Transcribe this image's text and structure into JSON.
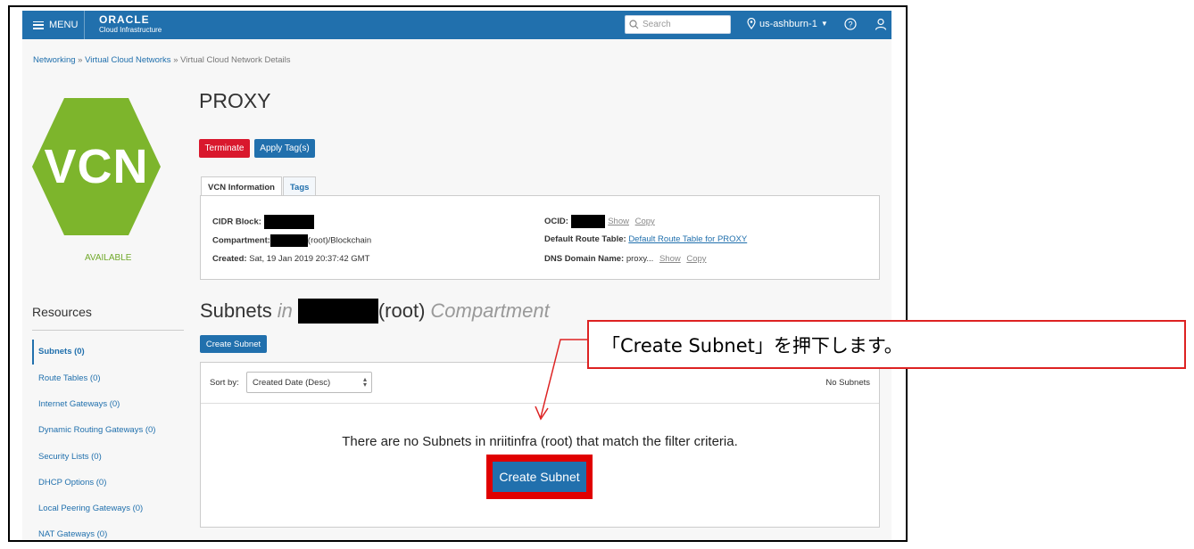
{
  "topbar": {
    "menu_label": "MENU",
    "brand_name": "ORACLE",
    "brand_sub": "Cloud Infrastructure",
    "search_placeholder": "Search",
    "region": "us-ashburn-1"
  },
  "breadcrumb": {
    "item1": "Networking",
    "sep": "»",
    "item2": "Virtual Cloud Networks",
    "item3": "Virtual Cloud Network Details"
  },
  "vcn": {
    "badge": "VCN",
    "status": "AVAILABLE",
    "title": "PROXY",
    "terminate_label": "Terminate",
    "apply_tags_label": "Apply Tag(s)"
  },
  "tabs": [
    "VCN Information",
    "Tags"
  ],
  "info": {
    "cidr_label": "CIDR Block:",
    "compartment_label": "Compartment:",
    "compartment_suffix": "(root)/Blockchain",
    "created_label": "Created:",
    "created_value": "Sat, 19 Jan 2019 20:37:42 GMT",
    "ocid_label": "OCID:",
    "show_label": "Show",
    "copy_label": "Copy",
    "route_table_label": "Default Route Table:",
    "route_table_value": "Default Route Table for PROXY",
    "dns_label": "DNS Domain Name:",
    "dns_value": "proxy..."
  },
  "resources": {
    "title": "Resources",
    "items": [
      "Subnets (0)",
      "Route Tables (0)",
      "Internet Gateways (0)",
      "Dynamic Routing Gateways (0)",
      "Security Lists (0)",
      "DHCP Options (0)",
      "Local Peering Gateways (0)",
      "NAT Gateways (0)"
    ]
  },
  "subnets": {
    "heading_prefix": "Subnets",
    "heading_in": "in",
    "heading_root": "(root)",
    "heading_suffix": "Compartment",
    "create_label": "Create Subnet",
    "sort_label": "Sort by:",
    "sort_value": "Created Date (Desc)",
    "count_label": "No Subnets",
    "empty_message": "There are no Subnets in nriitinfra (root) that match the filter criteria.",
    "big_create_label": "Create Subnet"
  },
  "annotation": {
    "callout_text": "「Create Subnet」を押下します。"
  },
  "colors": {
    "accent": "#2170ad",
    "danger": "#d9182d",
    "vcn_green": "#7db52c",
    "highlight": "#e00000"
  }
}
